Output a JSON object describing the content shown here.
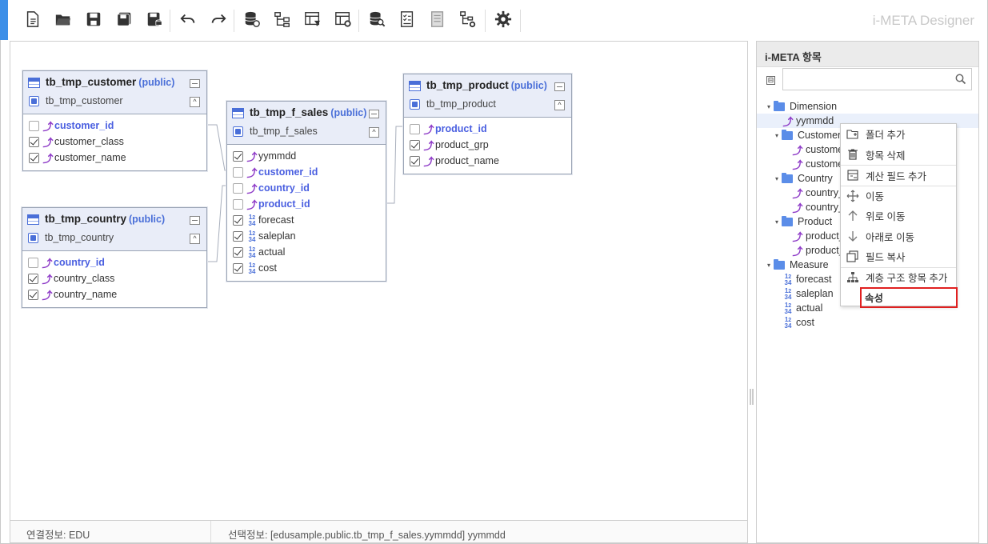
{
  "app_title": "i-META Designer",
  "colors": {
    "accent": "#3d8fe8",
    "key_field": "#4a5fe0",
    "dimension_icon": "#8e3bc7",
    "highlight": "#e02020"
  },
  "toolbar": {
    "buttons": [
      {
        "icon": "new-document-icon"
      },
      {
        "icon": "open-folder-icon"
      },
      {
        "icon": "save-icon"
      },
      {
        "icon": "save-as-icon"
      },
      {
        "icon": "save-db-icon"
      },
      {
        "icon": "undo-icon"
      },
      {
        "icon": "redo-icon"
      },
      {
        "icon": "db-link-icon"
      },
      {
        "icon": "hierarchy-icon"
      },
      {
        "icon": "table-filter-icon"
      },
      {
        "icon": "table-settings-icon"
      },
      {
        "icon": "db-search-icon"
      },
      {
        "icon": "checklist-icon"
      },
      {
        "icon": "document-icon"
      },
      {
        "icon": "tree-settings-icon"
      },
      {
        "icon": "gear-icon"
      }
    ]
  },
  "tables": [
    {
      "name": "tb_tmp_customer",
      "schema": "(public)",
      "alias": "tb_tmp_customer",
      "columns": [
        {
          "name": "customer_id",
          "checked": false,
          "key": true,
          "type": "dim"
        },
        {
          "name": "customer_class",
          "checked": true,
          "key": false,
          "type": "dim"
        },
        {
          "name": "customer_name",
          "checked": true,
          "key": false,
          "type": "dim"
        }
      ]
    },
    {
      "name": "tb_tmp_country",
      "schema": "(public)",
      "alias": "tb_tmp_country",
      "columns": [
        {
          "name": "country_id",
          "checked": false,
          "key": true,
          "type": "dim"
        },
        {
          "name": "country_class",
          "checked": true,
          "key": false,
          "type": "dim"
        },
        {
          "name": "country_name",
          "checked": true,
          "key": false,
          "type": "dim"
        }
      ]
    },
    {
      "name": "tb_tmp_f_sales",
      "schema": "(public)",
      "alias": "tb_tmp_f_sales",
      "columns": [
        {
          "name": "yymmdd",
          "checked": true,
          "key": false,
          "type": "dim"
        },
        {
          "name": "customer_id",
          "checked": false,
          "key": true,
          "type": "dim"
        },
        {
          "name": "country_id",
          "checked": false,
          "key": true,
          "type": "dim"
        },
        {
          "name": "product_id",
          "checked": false,
          "key": true,
          "type": "dim"
        },
        {
          "name": "forecast",
          "checked": true,
          "key": false,
          "type": "num"
        },
        {
          "name": "saleplan",
          "checked": true,
          "key": false,
          "type": "num"
        },
        {
          "name": "actual",
          "checked": true,
          "key": false,
          "type": "num"
        },
        {
          "name": "cost",
          "checked": true,
          "key": false,
          "type": "num"
        }
      ]
    },
    {
      "name": "tb_tmp_product",
      "schema": "(public)",
      "alias": "tb_tmp_product",
      "columns": [
        {
          "name": "product_id",
          "checked": false,
          "key": true,
          "type": "dim"
        },
        {
          "name": "product_grp",
          "checked": true,
          "key": false,
          "type": "dim"
        },
        {
          "name": "product_name",
          "checked": true,
          "key": false,
          "type": "dim"
        }
      ]
    }
  ],
  "status": {
    "connection": "연결정보: EDU",
    "selection": "선택정보: [edusample.public.tb_tmp_f_sales.yymmdd] yymmdd"
  },
  "panel": {
    "title": "i-META 항목",
    "collapse_glyph": "⊟",
    "search_placeholder": "",
    "tree": [
      {
        "label": "Dimension",
        "kind": "folder",
        "level": 0
      },
      {
        "label": "yymmdd",
        "kind": "dim",
        "level": 1,
        "selected": true
      },
      {
        "label": "Customer",
        "kind": "folder",
        "level": 1
      },
      {
        "label": "custome",
        "kind": "dim",
        "level": 2
      },
      {
        "label": "custome",
        "kind": "dim",
        "level": 2
      },
      {
        "label": "Country",
        "kind": "folder",
        "level": 1
      },
      {
        "label": "country_",
        "kind": "dim",
        "level": 2
      },
      {
        "label": "country_",
        "kind": "dim",
        "level": 2
      },
      {
        "label": "Product",
        "kind": "folder",
        "level": 1
      },
      {
        "label": "product_",
        "kind": "dim",
        "level": 2
      },
      {
        "label": "product_",
        "kind": "dim",
        "level": 2
      },
      {
        "label": "Measure",
        "kind": "folder",
        "level": 0
      },
      {
        "label": "forecast",
        "kind": "num",
        "level": 1
      },
      {
        "label": "saleplan",
        "kind": "num",
        "level": 1
      },
      {
        "label": "actual",
        "kind": "num",
        "level": 1
      },
      {
        "label": "cost",
        "kind": "num",
        "level": 1
      }
    ]
  },
  "context_menu": {
    "items": [
      {
        "label": "폴더 추가",
        "icon": "add-folder-icon"
      },
      {
        "label": "항목 삭제",
        "icon": "trash-icon"
      },
      {
        "label": "계산 필드 추가",
        "icon": "calc-field-icon",
        "sep": true
      },
      {
        "label": "이동",
        "icon": "move-icon",
        "sep": true
      },
      {
        "label": "위로 이동",
        "icon": "arrow-up-icon"
      },
      {
        "label": "아래로 이동",
        "icon": "arrow-down-icon"
      },
      {
        "label": "필드 복사",
        "icon": "copy-icon"
      },
      {
        "label": "계층 구조 항목 추가",
        "icon": "hierarchy-add-icon",
        "sep": true
      },
      {
        "label": "속성",
        "icon": "",
        "highlight": true
      }
    ]
  }
}
